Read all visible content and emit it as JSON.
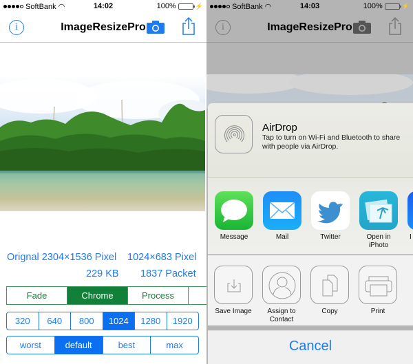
{
  "left_screen": {
    "status_bar": {
      "carrier": "SoftBank",
      "time": "14:02",
      "battery": "100%",
      "signal_bars": 4
    },
    "nav": {
      "title": "ImageResizePro",
      "info_icon": "info-icon",
      "camera_icon": "camera-icon",
      "share_icon": "share-icon"
    },
    "info": {
      "original_label": "Orignal 2304×1536 Pixel",
      "resized_label": "1024×683 Pixel",
      "size": "229 KB",
      "packet": "1837 Packet"
    },
    "filter_segment": {
      "items": [
        "Fade",
        "Chrome",
        "Process",
        ""
      ],
      "selected": "Chrome"
    },
    "size_segment": {
      "items": [
        "320",
        "640",
        "800",
        "1024",
        "1280",
        "1920"
      ],
      "selected": "1024"
    },
    "quality_segment": {
      "items": [
        "worst",
        "default",
        "best",
        "max"
      ],
      "selected": "default"
    },
    "colors": {
      "accent_blue": "#1e7cf0",
      "accent_green": "#13803a"
    }
  },
  "right_screen": {
    "status_bar": {
      "carrier": "SoftBank",
      "time": "14:03",
      "battery": "100%"
    },
    "nav": {
      "title": "ImageResizePro"
    },
    "share_sheet": {
      "airdrop": {
        "title": "AirDrop",
        "description": "Tap to turn on Wi-Fi and Bluetooth to share with people via AirDrop."
      },
      "apps": [
        {
          "label": "Message",
          "icon": "message-icon"
        },
        {
          "label": "Mail",
          "icon": "mail-icon"
        },
        {
          "label": "Twitter",
          "icon": "twitter-icon"
        },
        {
          "label": "Open in iPhoto",
          "icon": "iphoto-icon"
        },
        {
          "label": "I",
          "icon": "app-icon"
        }
      ],
      "actions": [
        {
          "label": "Save Image",
          "icon": "save-image-icon"
        },
        {
          "label": "Assign to Contact",
          "icon": "contact-icon"
        },
        {
          "label": "Copy",
          "icon": "copy-icon"
        },
        {
          "label": "Print",
          "icon": "print-icon"
        }
      ],
      "cancel_label": "Cancel"
    }
  }
}
